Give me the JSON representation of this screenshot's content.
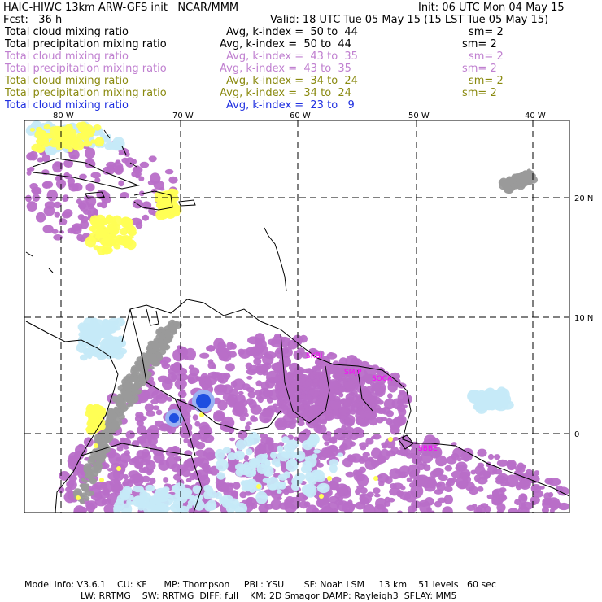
{
  "header": {
    "model_title": "HAIC-HIWC 13km ARW-GFS init   NCAR/MMM",
    "init_time": "Init: 06 UTC Mon 04 May 15",
    "forecast": "Fcst:   36 h",
    "valid_time": "Valid: 18 UTC Tue 05 May 15 (15 LST Tue 05 May 15)"
  },
  "legend": [
    {
      "field": "Total cloud mixing ratio",
      "avg": "Avg, k-index =  50 to  44",
      "sm": "sm= 2",
      "color": "#000000"
    },
    {
      "field": "Total precipitation mixing ratio",
      "avg": "Avg, k-index =  50 to  44",
      "sm": "sm= 2",
      "color": "#000000"
    },
    {
      "field": "Total cloud mixing ratio",
      "avg": "Avg, k-index =  43 to  35",
      "sm": "sm= 2",
      "color": "#c080d0"
    },
    {
      "field": "Total precipitation mixing ratio",
      "avg": "Avg, k-index =  43 to  35",
      "sm": "sm= 2",
      "color": "#c080d0"
    },
    {
      "field": "Total cloud mixing ratio",
      "avg": "Avg, k-index =  34 to  24",
      "sm": "sm= 2",
      "color": "#8a8a10"
    },
    {
      "field": "Total precipitation mixing ratio",
      "avg": "Avg, k-index =  34 to  24",
      "sm": "sm= 2",
      "color": "#8a8a10"
    },
    {
      "field": "Total cloud mixing ratio",
      "avg": "Avg, k-index =  23 to   9",
      "sm": "",
      "color": "#2030e0"
    }
  ],
  "map": {
    "lon_labels": [
      "80 W",
      "70 W",
      "60 W",
      "50 W",
      "40 W"
    ],
    "lat_labels": [
      "20 N",
      "10 N",
      "0"
    ],
    "place_labels": [
      "SKBI",
      "SMJP",
      "SOCA",
      "SBBE"
    ],
    "colors": {
      "purple": "#b86ec8",
      "gray": "#9a9a9a",
      "yellow": "#ffff55",
      "lightblue": "#c6eaf8",
      "blue": "#1e4fe0",
      "magenta": "#ff00ff"
    }
  },
  "footer": {
    "line1": "Model Info: V3.6.1    CU: KF      MP: Thompson     PBL: YSU       SF: Noah LSM     13 km    51 levels   60 sec",
    "line2": "LW: RRTMG    SW: RRTMG  DIFF: full    KM: 2D Smagor DAMP: Rayleigh3  SFLAY: MM5"
  }
}
